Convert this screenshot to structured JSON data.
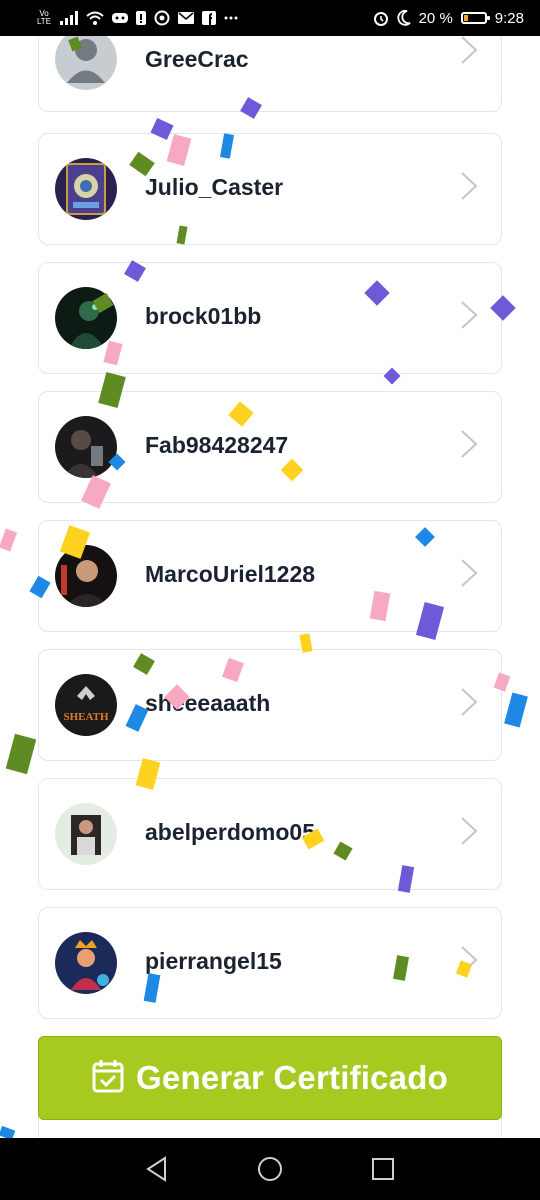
{
  "status_bar": {
    "volte": "Vo LTE",
    "battery_percent": "20 %",
    "battery_level": 0.2,
    "time": "9:28",
    "left_icons": [
      "signal-icon",
      "wifi-icon",
      "discord-icon",
      "alert-icon",
      "whatsapp-icon",
      "mail-icon",
      "facebook-icon",
      "more-icon"
    ],
    "right_icons": [
      "alarm-icon",
      "moon-icon"
    ]
  },
  "users": [
    {
      "name": "GreeCrac",
      "avatar": "default"
    },
    {
      "name": "Julio_Caster",
      "avatar": "game-card"
    },
    {
      "name": "brock01bb",
      "avatar": "dark-figure"
    },
    {
      "name": "Fab98428247",
      "avatar": "photo"
    },
    {
      "name": "MarcoUriel1228",
      "avatar": "selfie"
    },
    {
      "name": "sheeeaaath",
      "avatar": "sheath-logo"
    },
    {
      "name": "abelperdomo05",
      "avatar": "portrait"
    },
    {
      "name": "pierrangel15",
      "avatar": "game-character"
    }
  ],
  "avatar_text": {
    "sheath": "SHEATH"
  },
  "button": {
    "label": "Generar Certificado",
    "color": "#a6ca1f"
  },
  "confetti_colors": [
    "#6c5ad8",
    "#f6a9c0",
    "#1e88e5",
    "#ffd21f",
    "#5f8c22"
  ]
}
